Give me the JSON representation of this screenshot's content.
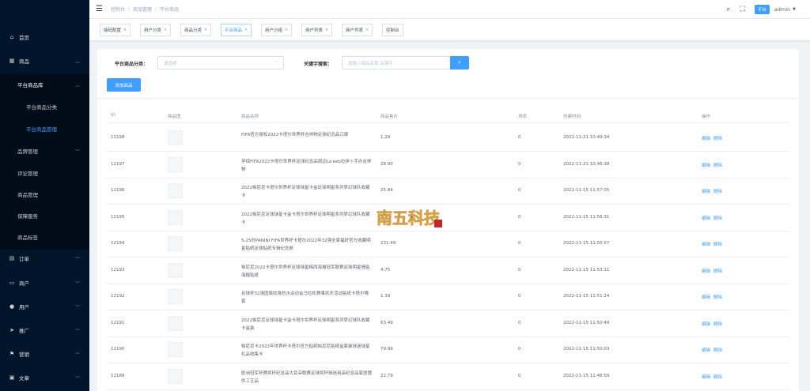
{
  "sidebar": {
    "items": [
      {
        "label": "首页",
        "icon": "home-icon",
        "level": "parent"
      },
      {
        "label": "商品",
        "icon": "shop-icon",
        "level": "parent",
        "expanded": true
      },
      {
        "label": "平台商品库",
        "level": "sub1",
        "expanded": true
      },
      {
        "label": "平台商品分类",
        "level": "sub2"
      },
      {
        "label": "平台商品管理",
        "level": "sub2",
        "active": true
      },
      {
        "label": "品牌管理",
        "level": "sub1b",
        "chevron": true
      },
      {
        "label": "评论管理",
        "level": "sub1b"
      },
      {
        "label": "商品管理",
        "level": "sub1b"
      },
      {
        "label": "保障服务",
        "level": "sub1b"
      },
      {
        "label": "商品标签",
        "level": "sub1b"
      },
      {
        "label": "订单",
        "icon": "order-icon",
        "level": "parent"
      },
      {
        "label": "商户",
        "icon": "merchant-icon",
        "level": "parent"
      },
      {
        "label": "用户",
        "icon": "user-icon",
        "level": "parent"
      },
      {
        "label": "推广",
        "icon": "promote-icon",
        "level": "parent"
      },
      {
        "label": "营销",
        "icon": "marketing-icon",
        "level": "parent"
      },
      {
        "label": "文章",
        "icon": "article-icon",
        "level": "parent"
      }
    ]
  },
  "header": {
    "breadcrumb": [
      "控制台",
      "商品管理",
      "平台商品"
    ],
    "role_badge": "平台",
    "user_name": "admin"
  },
  "tags": [
    {
      "label": "接码配置",
      "closable": true
    },
    {
      "label": "用户分类",
      "closable": true
    },
    {
      "label": "商品分类",
      "closable": true
    },
    {
      "label": "平台商品",
      "closable": true,
      "active": true
    },
    {
      "label": "用户分组",
      "closable": true
    },
    {
      "label": "用户列表",
      "closable": true
    },
    {
      "label": "商户列表",
      "closable": true
    },
    {
      "label": "控制台",
      "closable": false
    }
  ],
  "filters": {
    "category_label": "平台商品分类：",
    "category_placeholder": "请选择",
    "keyword_label": "关键字搜索：",
    "keyword_placeholder": "请输入商品名称,关键字"
  },
  "add_button": "添加商品",
  "table": {
    "columns": [
      "ID",
      "商品图",
      "商品名称",
      "商品售价",
      "排序",
      "创建时间",
      "操作"
    ],
    "actions": [
      "编辑",
      "删除"
    ],
    "rows": [
      {
        "id": "12198",
        "name": "FIFA官方授权2022卡塔尔世界杯吉祥物足球纪念品口罩",
        "price": "1.29",
        "sort": "0",
        "time": "2022-11-21 10:49:34"
      },
      {
        "id": "12197",
        "name": "孚缔FIFA2022卡塔尔世界杯足球纪念品周边La'eeb拉伊卜手办吉祥物",
        "price": "28.90",
        "sort": "0",
        "time": "2022-11-21 10:46:38"
      },
      {
        "id": "12196",
        "name": "2022帕尼尼卡塔尔世界杯足球球星卡盒足球明星系列梦幻球队收藏卡",
        "price": "25.84",
        "sort": "0",
        "time": "2022-11-15 11:57:05"
      },
      {
        "id": "12195",
        "name": "2022帕尼尼足球球星卡盒卡塔尔世界杯足球明星系列梦幻球队收藏卡",
        "price": "",
        "sort": "0",
        "time": "2022-11-15 11:56:31"
      },
      {
        "id": "12194",
        "name": "5-25时PANINI FIFA世界杯卡塔尔2022年32强全家福好官方收藏明星贴纸足球贴纸专辑纪念册",
        "price": "231.49",
        "sort": "0",
        "time": "2022-11-15 11:55:57"
      },
      {
        "id": "12193",
        "name": "帕尼尼2022卡塔尔世界杯足球球星梅西海报冠军联赛足球明星墙贴海报贴纸",
        "price": "4.75",
        "sort": "0",
        "time": "2022-11-15 11:53:11"
      },
      {
        "id": "12192",
        "name": "足球杯32强国旗纹身防水运动会马拉松赛事欢庆活动贴纸卡塔尔嘴套",
        "price": "1.39",
        "sort": "0",
        "time": "2022-11-15 11:51:24"
      },
      {
        "id": "12191",
        "name": "2022帕尼尼足球球星卡盒卡塔尔世界杯足球明星系列梦幻球队收藏卡盒装",
        "price": "63.49",
        "sort": "0",
        "time": "2022-11-15 11:50:49"
      },
      {
        "id": "12190",
        "name": "帕尼尼卡2022年世界杯卡塔尔官方贴纸帕尼尼贴纸盒套装球迷球星礼品收集卡",
        "price": "79.99",
        "sort": "0",
        "time": "2022-11-15 11:50:03"
      },
      {
        "id": "12189",
        "name": "欧洲冠军杯赛奖杯纪念品大耳朵联赛足球奖杯球迷用品纪念品家居摆件工艺品",
        "price": "22.79",
        "sort": "0",
        "time": "2022-11-15 11:48:59"
      }
    ]
  },
  "watermark": "南五科技",
  "colors": {
    "accent": "#409eff",
    "sidebar_bg": "#001529",
    "sidebar_sub_bg": "#000c17"
  }
}
